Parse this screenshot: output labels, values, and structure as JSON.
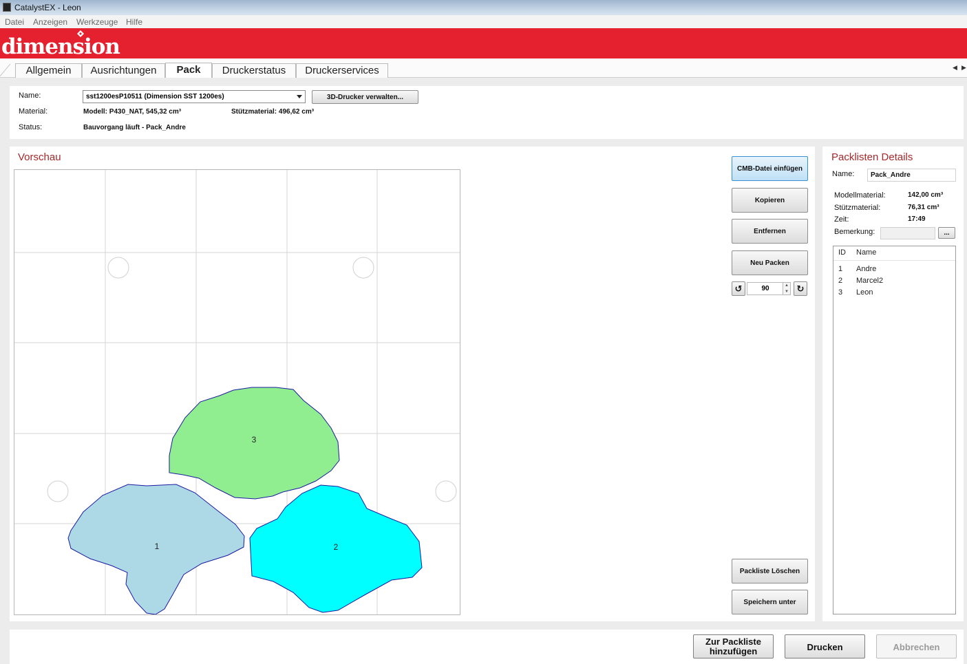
{
  "window": {
    "title": "CatalystEX - Leon"
  },
  "menu": [
    "Datei",
    "Anzeigen",
    "Werkzeuge",
    "Hilfe"
  ],
  "brand": {
    "logo_text": "dimension",
    "registered": "®"
  },
  "tabs": [
    "Allgemein",
    "Ausrichtungen",
    "Pack",
    "Druckerstatus",
    "Druckerservices"
  ],
  "active_tab": "Pack",
  "printer": {
    "name_label": "Name:",
    "name_value": "sst1200esP10511  (Dimension SST 1200es)",
    "manage_button": "3D-Drucker verwalten...",
    "material_label": "Material:",
    "model_material": "Modell: P430_NAT,  545,32 cm³",
    "support_material": "Stützmaterial: 496,62 cm³",
    "status_label": "Status:",
    "status_value": "Bauvorgang läuft - Pack_Andre"
  },
  "preview": {
    "title": "Vorschau",
    "parts": [
      {
        "id": "1",
        "color": "#add8e6"
      },
      {
        "id": "2",
        "color": "#00ffff"
      },
      {
        "id": "3",
        "color": "#90ee90"
      }
    ]
  },
  "actions": {
    "insert_cmb": "CMB-Datei einfügen",
    "copy": "Kopieren",
    "remove": "Entfernen",
    "repack": "Neu Packen",
    "rotation_value": "90",
    "delete_packlist": "Packliste Löschen",
    "save_as": "Speichern unter"
  },
  "details": {
    "title": "Packlisten Details",
    "name_label": "Name:",
    "name_value": "Pack_Andre",
    "model_material_label": "Modellmaterial:",
    "model_material_value": "142,00 cm³",
    "support_material_label": "Stützmaterial:",
    "support_material_value": "76,31 cm³",
    "time_label": "Zeit:",
    "time_value": "17:49",
    "remark_label": "Bemerkung:",
    "remark_button": "...",
    "list_headers": [
      "ID",
      "Name"
    ],
    "list_rows": [
      {
        "id": "1",
        "name": "Andre"
      },
      {
        "id": "2",
        "name": "Marcel2"
      },
      {
        "id": "3",
        "name": "Leon"
      }
    ]
  },
  "footer": {
    "add_line1": "Zur Packliste",
    "add_line2": "hinzufügen",
    "print": "Drucken",
    "cancel": "Abbrechen"
  },
  "colors": {
    "banner": "#e5202f",
    "section_title": "#a7282a",
    "part_outline": "#1a1aa0"
  }
}
